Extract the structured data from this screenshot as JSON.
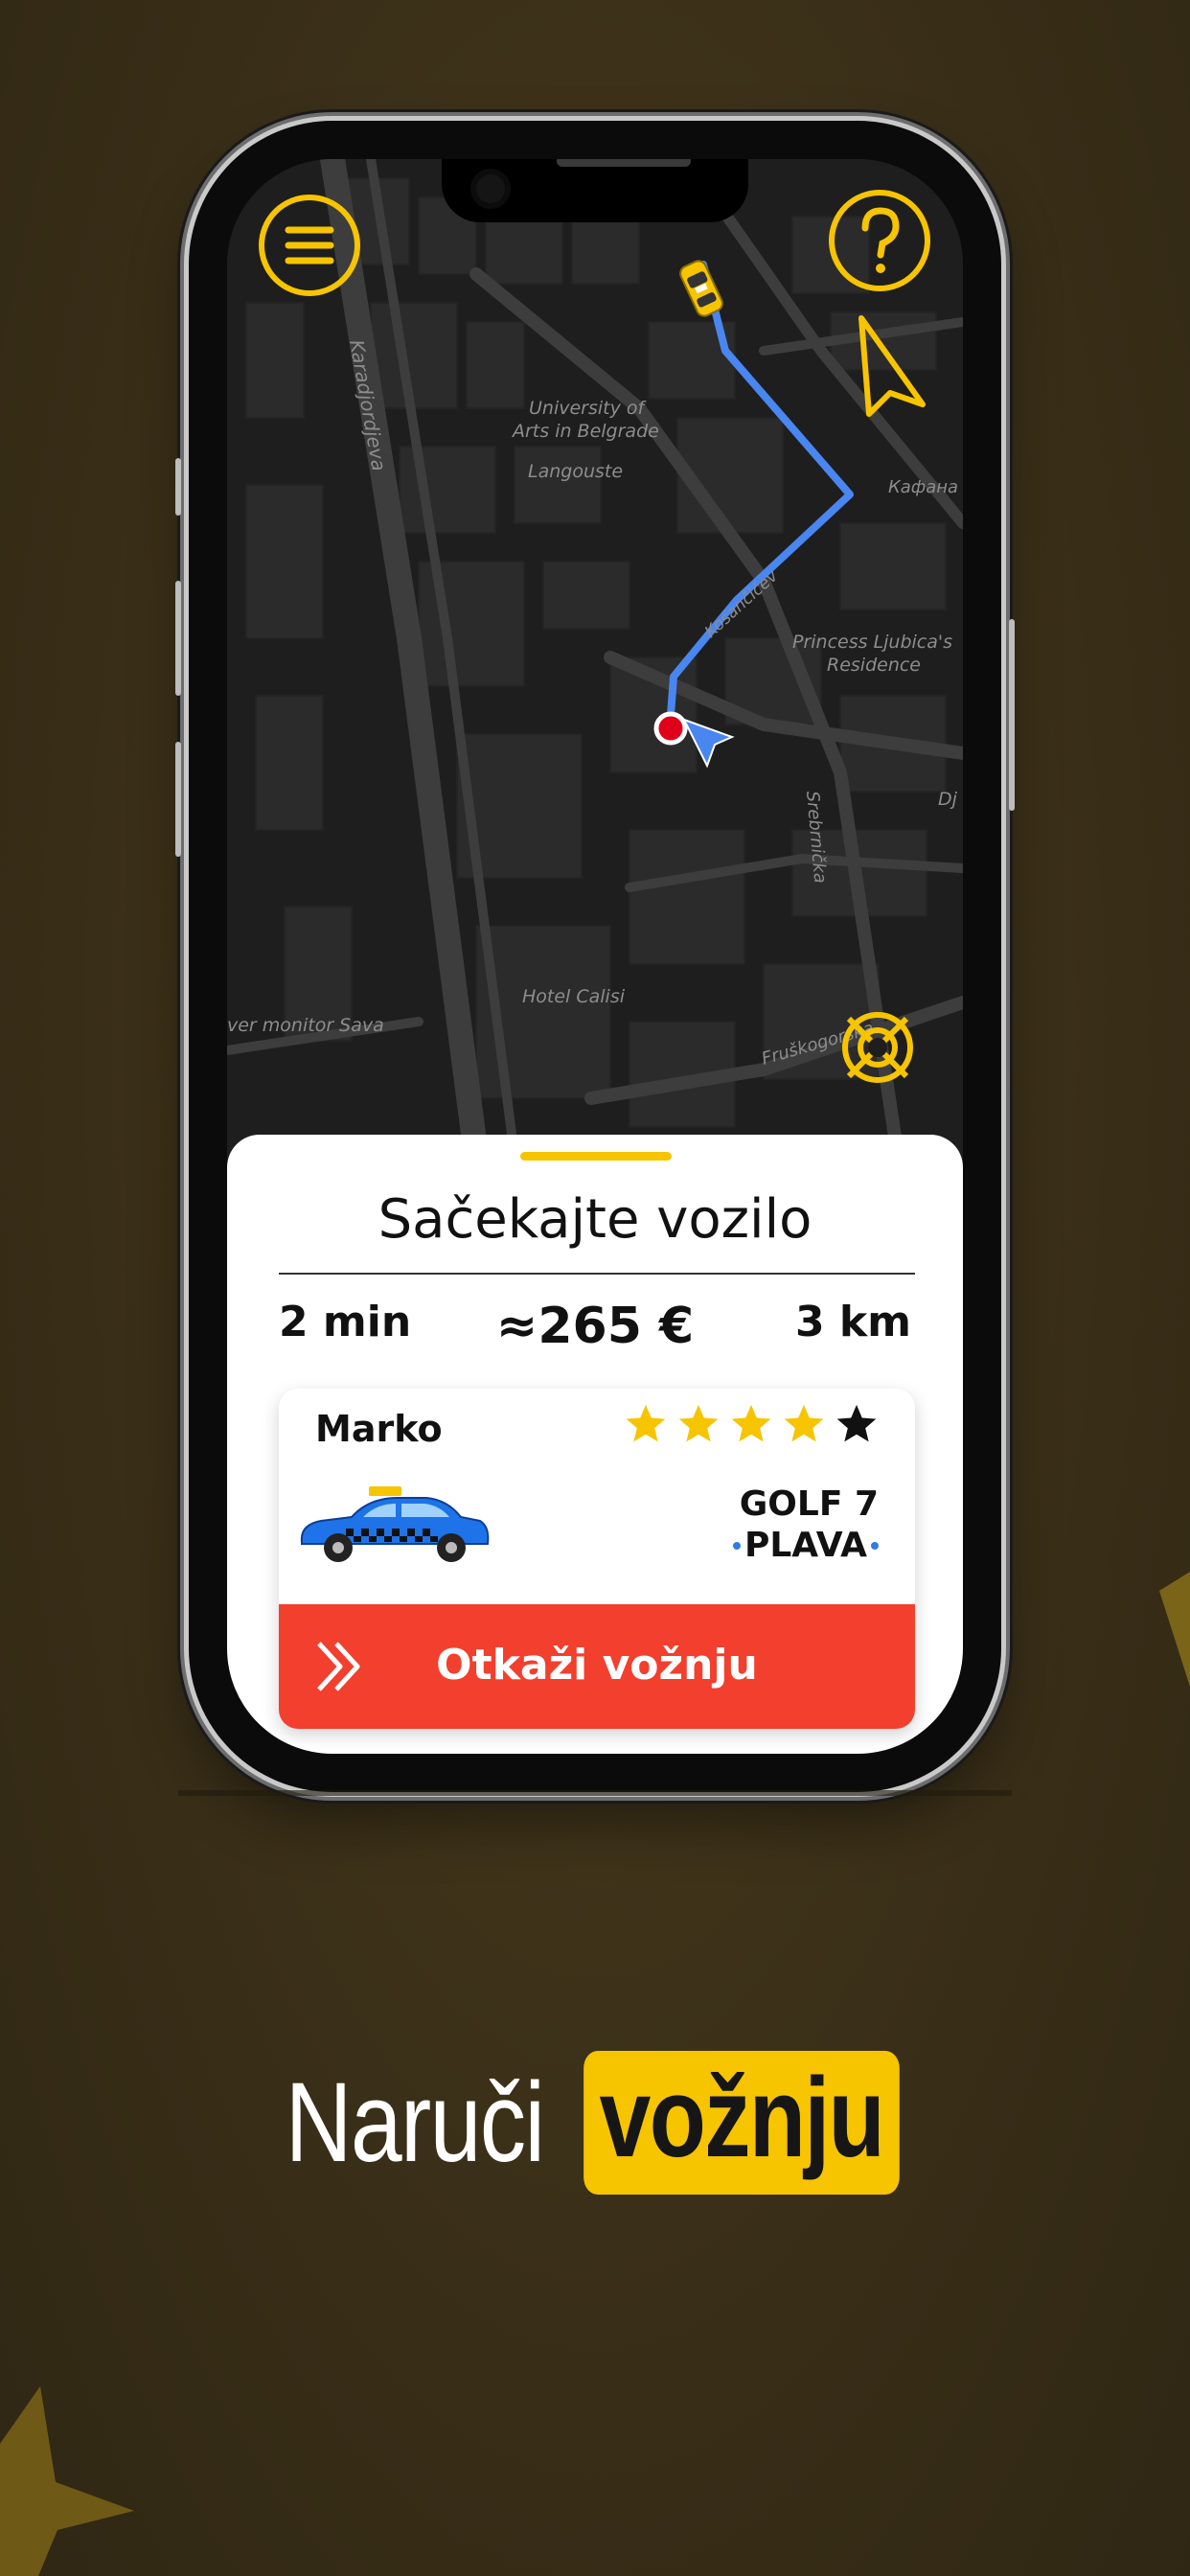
{
  "colors": {
    "background": "#3a2f18",
    "accent_yellow": "#f7c400",
    "route_blue": "#4a86f0",
    "cancel_red": "#f23f2e",
    "map_dark": "#1e1e1e"
  },
  "map": {
    "labels": {
      "karadjordjeva": "Karadjordjeva",
      "university_line1": "University of",
      "university_line2": "Arts in Belgrade",
      "langouste": "Langouste",
      "kafana": "Кафана",
      "kosancicev": "Kosančićev",
      "princess_line1": "Princess Ljubica's",
      "princess_line2": "Residence",
      "dj": "Dj",
      "srebrnicka": "Srebrnička",
      "hotel_calisi": "Hotel Calisi",
      "river_monitor": "ver monitor Sava",
      "fruskogorska": "Fruškogorska"
    },
    "icons": {
      "menu": "hamburger-menu-icon",
      "help": "question-mark-icon",
      "locate": "navigation-arrow-icon",
      "recenter": "target-crosshair-icon",
      "taxi": "taxi-car-icon",
      "user_location": "location-pin-icon"
    }
  },
  "ride": {
    "title": "Sačekajte vozilo",
    "time": "2 min",
    "price": "≈265 €",
    "distance": "3 km"
  },
  "driver": {
    "name": "Marko",
    "rating": 4,
    "rating_max": 5,
    "car_model": "GOLF 7",
    "car_color": "PLAVA"
  },
  "actions": {
    "cancel_label": "Otkaži vožnju"
  },
  "headline": {
    "part1": "Naruči",
    "part2": "vožnju"
  }
}
